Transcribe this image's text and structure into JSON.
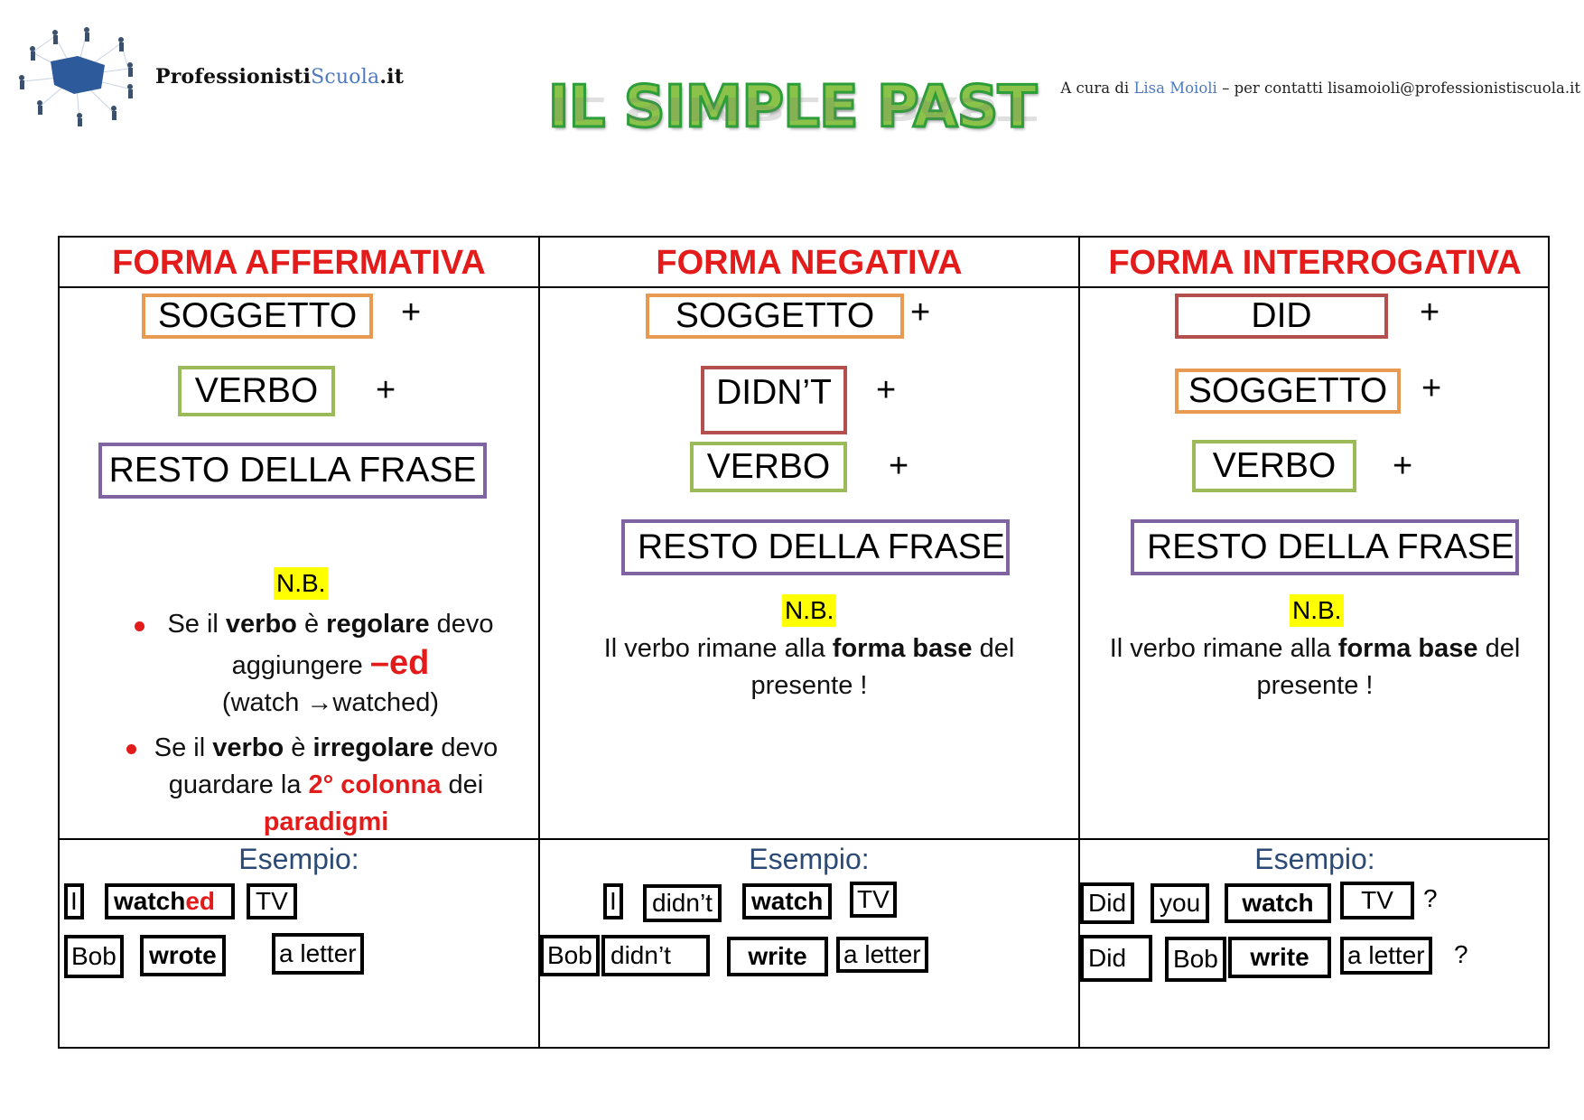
{
  "header": {
    "brand": {
      "main": "Professionisti",
      "accent": "Scuola",
      "tld": ".it"
    },
    "logo_icon": "network-people-logo",
    "title": "IL SIMPLE PAST",
    "credit": {
      "prefix": "A cura di ",
      "author": "Lisa Moioli",
      "suffix": "  – per contatti lisamoioli@professionistiscuola.it"
    }
  },
  "colors": {
    "soggetto": "#e99a52",
    "verbo": "#9bbb59",
    "resto": "#8064a2",
    "ausiliare": "#b3504e",
    "heading": "#e31b1b",
    "highlight": "#ffff00",
    "esempio": "#2b4a75",
    "title_fill": "#8bc34a",
    "title_stroke": "#2e9e3a"
  },
  "columns": [
    {
      "heading": "FORMA AFFERMATIVA",
      "structure": [
        {
          "label": "SOGGETTO",
          "role": "soggetto",
          "plus": "+"
        },
        {
          "label": "VERBO",
          "role": "verbo",
          "plus": "+"
        },
        {
          "label": "RESTO DELLA FRASE",
          "role": "resto",
          "plus": ""
        }
      ],
      "nb": "N.B.",
      "notes": {
        "b1_a": "Se il ",
        "b1_b": "verbo",
        "b1_c": " è ",
        "b1_d": "regolare",
        "b1_e": " devo",
        "b1_f": "aggiungere ",
        "b1_g": "–ed",
        "b1_h": "(watch →watched)",
        "b2_a": "Se il ",
        "b2_b": "verbo",
        "b2_c": " è ",
        "b2_d": "irregolare",
        "b2_e": " devo",
        "b2_f": "guardare la ",
        "b2_g": "2° colonna",
        "b2_h": " dei",
        "b2_i": "paradigmi"
      },
      "example_label": "Esempio:",
      "examples": [
        {
          "words": [
            "I",
            "watch",
            "ed",
            "TV"
          ]
        },
        {
          "words": [
            "Bob",
            "wrote",
            "a letter"
          ]
        }
      ]
    },
    {
      "heading": "FORMA NEGATIVA",
      "structure": [
        {
          "label": "SOGGETTO",
          "role": "soggetto",
          "plus": "+"
        },
        {
          "label": "DIDN’T",
          "role": "ausiliare",
          "plus": "+"
        },
        {
          "label": "VERBO",
          "role": "verbo",
          "plus": "+"
        },
        {
          "label": "RESTO DELLA FRASE",
          "role": "resto",
          "plus": ""
        }
      ],
      "nb": "N.B.",
      "notes": {
        "a": "Il verbo rimane alla ",
        "b": "forma base",
        "c": " del",
        "d": "presente !"
      },
      "example_label": "Esempio:",
      "examples": [
        {
          "words": [
            "I",
            "didn’t",
            "watch",
            "TV"
          ]
        },
        {
          "words": [
            "Bob",
            "didn’t",
            "write",
            "a letter"
          ]
        }
      ]
    },
    {
      "heading": "FORMA INTERROGATIVA",
      "structure": [
        {
          "label": "DID",
          "role": "ausiliare",
          "plus": "+"
        },
        {
          "label": "SOGGETTO",
          "role": "soggetto",
          "plus": "+"
        },
        {
          "label": "VERBO",
          "role": "verbo",
          "plus": "+"
        },
        {
          "label": "RESTO DELLA FRASE",
          "role": "resto",
          "plus": ""
        }
      ],
      "nb": "N.B.",
      "notes": {
        "a": "Il verbo rimane alla ",
        "b": "forma base",
        "c": " del",
        "d": "presente !"
      },
      "example_label": "Esempio:",
      "examples": [
        {
          "words": [
            "Did",
            "you",
            "watch",
            "TV",
            "?"
          ]
        },
        {
          "words": [
            "Did",
            "Bob",
            "write",
            "a letter",
            "?"
          ]
        }
      ]
    }
  ]
}
